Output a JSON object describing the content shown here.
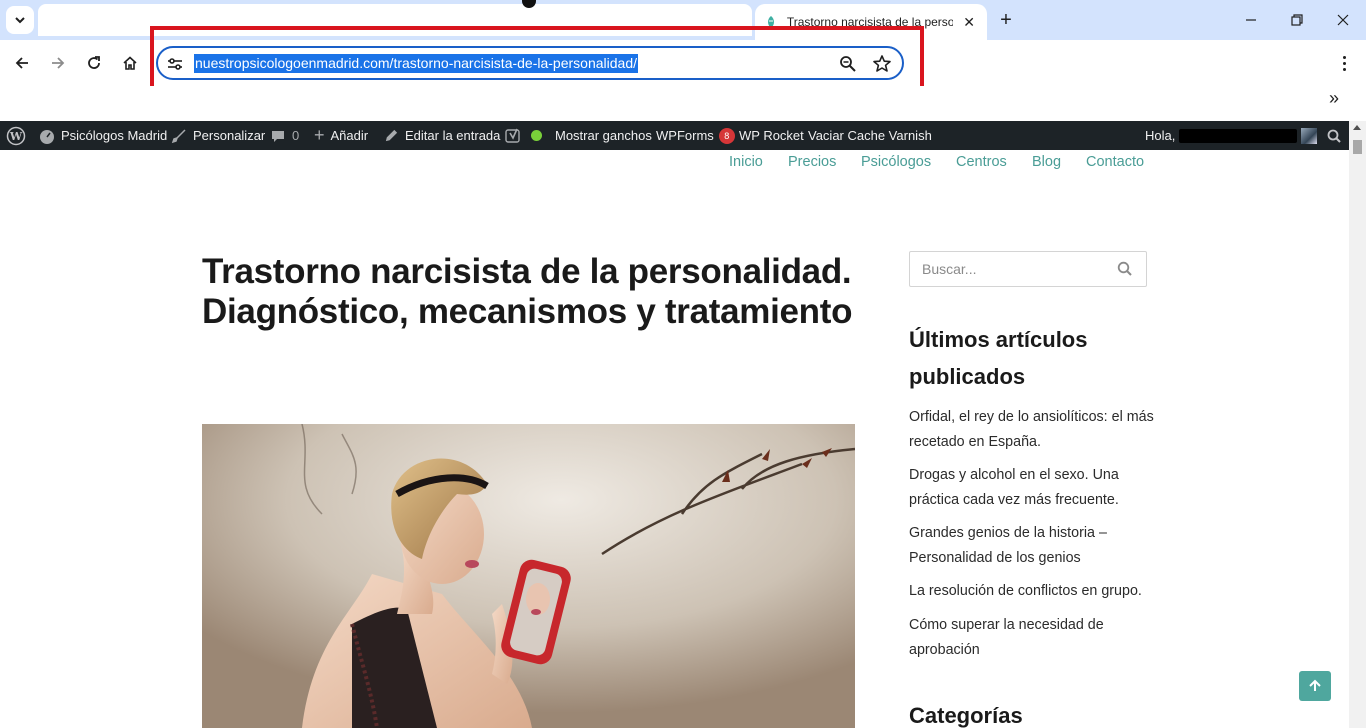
{
  "browser": {
    "tab": {
      "title": "Trastorno narcisista de la personalidad. Diagnóstico, mecanismos y tratamiento"
    },
    "url": "nuestropsicologoenmadrid.com/trastorno-narcisista-de-la-personalidad/",
    "icons": [
      "tab-search-icon",
      "favicon",
      "close-icon",
      "plus-icon",
      "minimize-icon",
      "restore-icon",
      "close-window-icon",
      "back-icon",
      "forward-icon",
      "reload-icon",
      "home-icon",
      "site-settings-icon",
      "zoom-icon",
      "star-icon",
      "more-icon",
      "chevrons-icon"
    ],
    "accent": "#1a73e8",
    "highlight_color": "#d9151e"
  },
  "adminbar": {
    "site_name": "Psicólogos Madrid",
    "customize": "Personalizar",
    "comments": "0",
    "add_new": "Añadir",
    "edit_post": "Editar la entrada",
    "show_hooks": "Mostrar ganchos",
    "wpforms": "WPForms",
    "wpforms_count": "8",
    "wp_rocket": "WP Rocket",
    "varnish": "Vaciar Cache Varnish",
    "greeting": "Hola,",
    "background": "#1d2327"
  },
  "nav": {
    "items": [
      "Inicio",
      "Precios",
      "Psicólogos",
      "Centros",
      "Blog",
      "Contacto"
    ],
    "color": "#4a9d96"
  },
  "article": {
    "title": "Trastorno narcisista de la personalidad. Diagnóstico, mecanismos y tratamiento"
  },
  "sidebar": {
    "search_placeholder": "Buscar...",
    "recent_title_line1": "Últimos artículos",
    "recent_title_line2": "publicados",
    "recent_posts": [
      "Orfidal, el rey de lo ansiolíticos: el más recetado en España.",
      "Drogas y alcohol en el sexo. Una práctica cada vez más frecuente.",
      "Grandes genios de la historia – Personalidad de los genios",
      "La resolución de conflictos en grupo.",
      "Cómo superar la necesidad de aprobación"
    ],
    "categories_title": "Categorías"
  }
}
